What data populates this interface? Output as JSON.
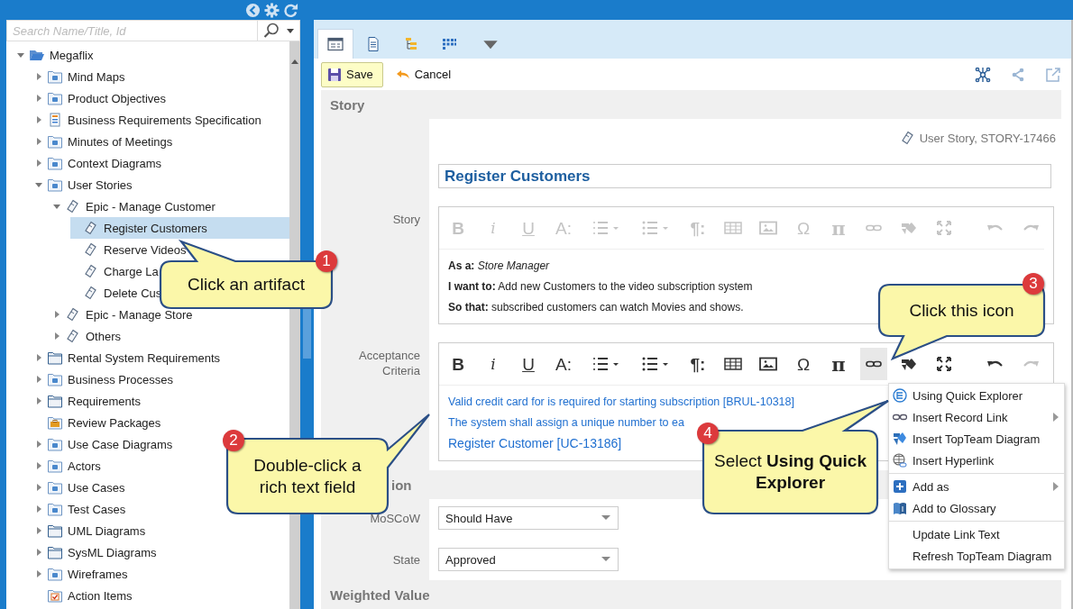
{
  "sidebar": {
    "search": {
      "placeholder": "Search Name/Title, Id"
    },
    "tree": [
      {
        "label": "Megaflix",
        "kind": "project",
        "expanded": true,
        "selected": false,
        "children": [
          {
            "label": "Mind Maps",
            "kind": "category",
            "expanded": false,
            "selected": false
          },
          {
            "label": "Product Objectives",
            "kind": "category",
            "expanded": false,
            "selected": false
          },
          {
            "label": "Business Requirements Specification",
            "kind": "spec",
            "expanded": false,
            "selected": false
          },
          {
            "label": "Minutes of Meetings",
            "kind": "category",
            "expanded": false,
            "selected": false
          },
          {
            "label": "Context Diagrams",
            "kind": "category",
            "expanded": false,
            "selected": false
          },
          {
            "label": "User Stories",
            "kind": "category",
            "expanded": true,
            "selected": false,
            "children": [
              {
                "label": "Epic - Manage Customer",
                "kind": "story",
                "expanded": true,
                "selected": false,
                "children": [
                  {
                    "label": "Register Customers",
                    "kind": "story",
                    "selected": true
                  },
                  {
                    "label": "Reserve Videos",
                    "kind": "story",
                    "selected": false
                  },
                  {
                    "label": "Charge La",
                    "kind": "story",
                    "selected": false
                  },
                  {
                    "label": "Delete Cus",
                    "kind": "story",
                    "selected": false
                  }
                ]
              },
              {
                "label": "Epic - Manage Store",
                "kind": "story",
                "expanded": false,
                "selected": false
              },
              {
                "label": "Others",
                "kind": "story",
                "expanded": false,
                "selected": false
              }
            ]
          },
          {
            "label": "Rental System Requirements",
            "kind": "folder",
            "expanded": false,
            "selected": false
          },
          {
            "label": "Business Processes",
            "kind": "category",
            "expanded": false,
            "selected": false
          },
          {
            "label": "Requirements",
            "kind": "folder",
            "expanded": false,
            "selected": false
          },
          {
            "label": "Review Packages",
            "kind": "package",
            "selected": false
          },
          {
            "label": "Use Case Diagrams",
            "kind": "category",
            "expanded": false,
            "selected": false
          },
          {
            "label": "Actors",
            "kind": "category",
            "expanded": false,
            "selected": false
          },
          {
            "label": "Use Cases",
            "kind": "category",
            "expanded": false,
            "selected": false
          },
          {
            "label": "Test Cases",
            "kind": "category",
            "expanded": false,
            "selected": false
          },
          {
            "label": "UML Diagrams",
            "kind": "folder",
            "expanded": false,
            "selected": false
          },
          {
            "label": "SysML Diagrams",
            "kind": "folder",
            "expanded": false,
            "selected": false
          },
          {
            "label": "Wireframes",
            "kind": "category",
            "expanded": false,
            "selected": false
          },
          {
            "label": "Action Items",
            "kind": "action",
            "selected": false
          }
        ]
      }
    ]
  },
  "tabs": [
    {
      "kind": "form",
      "selected": true
    },
    {
      "kind": "document",
      "selected": false
    },
    {
      "kind": "tree",
      "selected": false
    },
    {
      "kind": "grid",
      "selected": false
    },
    {
      "kind": "more",
      "selected": false
    }
  ],
  "toolbar": {
    "save": "Save",
    "cancel": "Cancel"
  },
  "form": {
    "sections": [
      {
        "title": "Story",
        "meta": "User Story, STORY-17466",
        "name": "Register Customers",
        "fields": [
          {
            "kind": "editor",
            "label": "Story",
            "toolbar": [
              {
                "kind": "glyph-bold",
                "text": "B",
                "disabled": true,
                "pressed": false
              },
              {
                "kind": "glyph-italic",
                "text": "i",
                "disabled": true,
                "pressed": false
              },
              {
                "kind": "glyph-underline",
                "text": "U",
                "disabled": true,
                "pressed": false
              },
              {
                "kind": "glyph",
                "text": "A:",
                "disabled": true,
                "pressed": false
              },
              {
                "kind": "numbered-list",
                "disabled": true,
                "pressed": false
              },
              {
                "kind": "bullet-list",
                "disabled": true,
                "pressed": false
              },
              {
                "kind": "glyph-bold",
                "text": "¶:",
                "disabled": true,
                "pressed": false
              },
              {
                "kind": "table",
                "disabled": true,
                "pressed": false
              },
              {
                "kind": "image",
                "disabled": true,
                "pressed": false
              },
              {
                "kind": "glyph",
                "text": "Ω",
                "disabled": true,
                "pressed": false
              },
              {
                "kind": "glyph-serif",
                "text": "π",
                "disabled": true,
                "pressed": false
              },
              {
                "kind": "link",
                "disabled": true,
                "pressed": false
              },
              {
                "kind": "diagram",
                "disabled": true,
                "pressed": false
              },
              {
                "kind": "fullscreen",
                "disabled": true,
                "pressed": false
              },
              {
                "kind": "undo",
                "disabled": true,
                "pressed": false
              },
              {
                "kind": "redo",
                "disabled": true,
                "pressed": false
              }
            ],
            "lines": [
              {
                "kind": "text",
                "text": "**As a:** *Store Manager*"
              },
              {
                "kind": "text",
                "text": "**I want to:** Add new Customers to the video subscription system"
              },
              {
                "kind": "text",
                "text": "**So that:** subscribed customers can watch Movies and shows."
              }
            ]
          },
          {
            "kind": "editor",
            "label": "Acceptance Criteria",
            "toolbar": [
              {
                "kind": "glyph-bold",
                "text": "B",
                "disabled": false,
                "pressed": false
              },
              {
                "kind": "glyph-italic",
                "text": "i",
                "disabled": false,
                "pressed": false
              },
              {
                "kind": "glyph-underline",
                "text": "U",
                "disabled": false,
                "pressed": false
              },
              {
                "kind": "glyph",
                "text": "A:",
                "disabled": false,
                "pressed": false
              },
              {
                "kind": "numbered-list",
                "disabled": false,
                "pressed": false
              },
              {
                "kind": "bullet-list",
                "disabled": false,
                "pressed": false
              },
              {
                "kind": "glyph-bold",
                "text": "¶:",
                "disabled": false,
                "pressed": false
              },
              {
                "kind": "table",
                "disabled": false,
                "pressed": false
              },
              {
                "kind": "image",
                "disabled": false,
                "pressed": false
              },
              {
                "kind": "glyph",
                "text": "Ω",
                "disabled": false,
                "pressed": false
              },
              {
                "kind": "glyph-serif",
                "text": "π",
                "disabled": false,
                "pressed": false
              },
              {
                "kind": "link",
                "disabled": false,
                "pressed": true
              },
              {
                "kind": "diagram",
                "disabled": false,
                "pressed": false
              },
              {
                "kind": "fullscreen",
                "disabled": false,
                "pressed": false
              },
              {
                "kind": "undo",
                "disabled": false,
                "pressed": false
              },
              {
                "kind": "redo",
                "disabled": true,
                "pressed": false
              }
            ],
            "lines": [
              {
                "kind": "link",
                "text": "Valid credit card for is required for starting subscription [BRUL-10318]"
              },
              {
                "kind": "link",
                "text": "The system shall assign a unique number to ea"
              },
              {
                "kind": "link-large",
                "text": "Register Customer [UC-13186]"
              }
            ]
          }
        ]
      },
      {
        "title": "ion",
        "fields": [
          {
            "kind": "select",
            "label": "MoSCoW",
            "value": "Should Have"
          },
          {
            "kind": "select",
            "label": "State",
            "value": "Approved"
          }
        ]
      },
      {
        "title": "Weighted Value"
      }
    ]
  },
  "menu": {
    "groups": [
      [
        {
          "kind": "explorer",
          "label": "Using Quick Explorer",
          "submenu": false
        },
        {
          "kind": "record-link",
          "label": "Insert Record Link",
          "submenu": true
        },
        {
          "kind": "diagram",
          "label": "Insert TopTeam Diagram",
          "submenu": false
        },
        {
          "kind": "hyperlink",
          "label": "Insert Hyperlink",
          "submenu": false
        }
      ],
      [
        {
          "kind": "add",
          "label": "Add as",
          "submenu": true
        },
        {
          "kind": "glossary",
          "label": "Add to Glossary",
          "submenu": false
        }
      ],
      [
        {
          "kind": "none",
          "label": "Update Link Text",
          "submenu": false
        },
        {
          "kind": "none",
          "label": "Refresh TopTeam Diagram",
          "submenu": false
        }
      ]
    ]
  },
  "callouts": [
    {
      "number": "1",
      "text": "Click an artifact"
    },
    {
      "number": "2",
      "text": "Double-click a rich text field"
    },
    {
      "number": "3",
      "text": "Click this icon"
    },
    {
      "number": "4",
      "text": "Select **Using Quick Explorer**"
    }
  ]
}
